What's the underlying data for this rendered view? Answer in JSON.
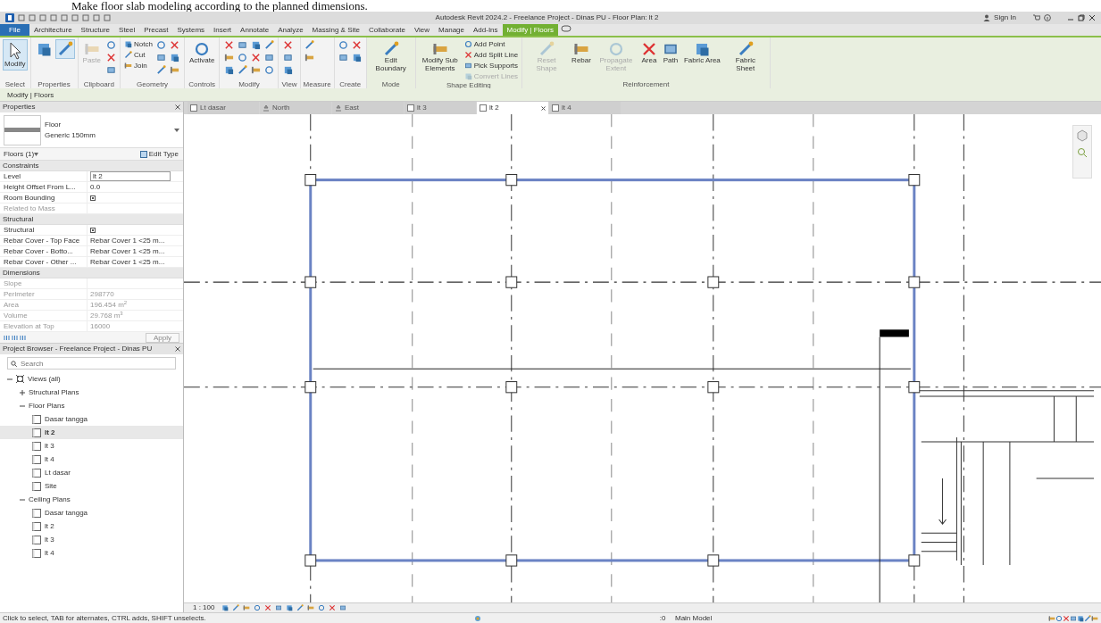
{
  "caption": "Make floor slab modeling according to the planned dimensions.",
  "title_bar": {
    "title": "Autodesk Revit 2024.2 - Freelance Project - Dinas PU - Floor Plan: lt 2",
    "sign_in": "Sign In"
  },
  "ribbon_tabs": [
    {
      "label": "File",
      "kind": "file",
      "selected": false
    },
    {
      "label": "Architecture",
      "kind": "tab",
      "selected": false
    },
    {
      "label": "Structure",
      "kind": "tab",
      "selected": false
    },
    {
      "label": "Steel",
      "kind": "tab",
      "selected": false
    },
    {
      "label": "Precast",
      "kind": "tab",
      "selected": false
    },
    {
      "label": "Systems",
      "kind": "tab",
      "selected": false
    },
    {
      "label": "Insert",
      "kind": "tab",
      "selected": false
    },
    {
      "label": "Annotate",
      "kind": "tab",
      "selected": false
    },
    {
      "label": "Analyze",
      "kind": "tab",
      "selected": false
    },
    {
      "label": "Massing & Site",
      "kind": "tab",
      "selected": false
    },
    {
      "label": "Collaborate",
      "kind": "tab",
      "selected": false
    },
    {
      "label": "View",
      "kind": "tab",
      "selected": false
    },
    {
      "label": "Manage",
      "kind": "tab",
      "selected": false
    },
    {
      "label": "Add-Ins",
      "kind": "tab",
      "selected": false
    },
    {
      "label": "Modify | Floors",
      "kind": "context",
      "selected": true
    }
  ],
  "ribbon_panels": [
    {
      "label": "Select",
      "buttons": [
        {
          "kind": "large",
          "label": "Modify",
          "selected": true
        }
      ]
    },
    {
      "label": "Properties",
      "buttons": [
        {
          "kind": "icon-large",
          "selected": false
        },
        {
          "kind": "icon-large",
          "selected": true
        }
      ]
    },
    {
      "label": "Clipboard",
      "buttons": [
        {
          "kind": "large",
          "label": "Paste",
          "disabled": true
        },
        {
          "kind": "icon"
        },
        {
          "kind": "icon"
        },
        {
          "kind": "icon"
        }
      ]
    },
    {
      "label": "Geometry",
      "buttons": [
        {
          "kind": "small",
          "label": "Notch"
        },
        {
          "kind": "small",
          "label": "Cut"
        },
        {
          "kind": "small",
          "label": "Join"
        },
        {
          "kind": "icon"
        },
        {
          "kind": "icon"
        },
        {
          "kind": "icon"
        },
        {
          "kind": "icon"
        },
        {
          "kind": "icon"
        },
        {
          "kind": "icon"
        }
      ]
    },
    {
      "label": "Controls",
      "buttons": [
        {
          "kind": "large",
          "label": "Activate"
        }
      ]
    },
    {
      "label": "Modify",
      "buttons": [
        {
          "kind": "icon"
        },
        {
          "kind": "icon"
        },
        {
          "kind": "icon"
        },
        {
          "kind": "icon"
        },
        {
          "kind": "icon"
        },
        {
          "kind": "icon"
        },
        {
          "kind": "icon"
        },
        {
          "kind": "icon"
        },
        {
          "kind": "icon"
        },
        {
          "kind": "icon"
        },
        {
          "kind": "icon"
        },
        {
          "kind": "icon"
        }
      ]
    },
    {
      "label": "View",
      "buttons": [
        {
          "kind": "icon"
        },
        {
          "kind": "icon"
        },
        {
          "kind": "icon"
        }
      ]
    },
    {
      "label": "Measure",
      "buttons": [
        {
          "kind": "icon"
        },
        {
          "kind": "icon"
        }
      ]
    },
    {
      "label": "Create",
      "buttons": [
        {
          "kind": "icon"
        },
        {
          "kind": "icon"
        },
        {
          "kind": "icon"
        },
        {
          "kind": "icon"
        }
      ]
    },
    {
      "label": "Mode",
      "buttons": [
        {
          "kind": "large",
          "label": "Edit Boundary"
        }
      ]
    },
    {
      "label": "Shape Editing",
      "buttons": [
        {
          "kind": "large",
          "label": "Modify Sub Elements"
        },
        {
          "kind": "small",
          "label": "Add Point"
        },
        {
          "kind": "small",
          "label": "Add Split Line"
        },
        {
          "kind": "small",
          "label": "Pick Supports"
        },
        {
          "kind": "small",
          "label": "Convert Lines",
          "disabled": true
        }
      ]
    },
    {
      "label": "Reinforcement",
      "buttons": [
        {
          "kind": "large",
          "label": "Reset Shape",
          "disabled": true
        },
        {
          "kind": "large",
          "label": "Rebar"
        },
        {
          "kind": "large",
          "label": "Propagate Extent",
          "disabled": true
        },
        {
          "kind": "large",
          "label": "Area"
        },
        {
          "kind": "large",
          "label": "Path"
        },
        {
          "kind": "large",
          "label": "Fabric Area"
        },
        {
          "kind": "large",
          "label": "Fabric Sheet"
        }
      ]
    }
  ],
  "context_bar": "Modify | Floors",
  "properties": {
    "title": "Properties",
    "type_family": "Floor",
    "type_name": "Generic 150mm",
    "filter": "Floors (1)",
    "edit_type": "Edit Type",
    "groups": [
      {
        "label": "Constraints",
        "rows": [
          {
            "name": "Level",
            "kind": "input",
            "value": "lt 2"
          },
          {
            "name": "Height Offset From L...",
            "kind": "text",
            "value": "0.0"
          },
          {
            "name": "Room Bounding",
            "kind": "checkbox",
            "checked": true
          },
          {
            "name": "Related to Mass",
            "kind": "text",
            "disabled": true
          }
        ]
      },
      {
        "label": "Structural",
        "rows": [
          {
            "name": "Structural",
            "kind": "checkbox",
            "checked": true
          },
          {
            "name": "Rebar Cover - Top Face",
            "kind": "text",
            "value": "Rebar Cover 1 <25 m..."
          },
          {
            "name": "Rebar Cover - Botto...",
            "kind": "text",
            "value": "Rebar Cover 1 <25 m..."
          },
          {
            "name": "Rebar Cover - Other ...",
            "kind": "text",
            "value": "Rebar Cover 1 <25 m..."
          }
        ]
      },
      {
        "label": "Dimensions",
        "rows": [
          {
            "name": "Slope",
            "kind": "text",
            "disabled": true
          },
          {
            "name": "Perimeter",
            "kind": "text",
            "value": "298770",
            "disabled": true
          },
          {
            "name": "Area",
            "kind": "text",
            "value": "196.454 m$^{2}$",
            "disabled": true
          },
          {
            "name": "Volume",
            "kind": "text",
            "value": "29.768 m$^{3}$",
            "disabled": true
          },
          {
            "name": "Elevation at Top",
            "kind": "text",
            "value": "16000",
            "disabled": true
          }
        ]
      }
    ],
    "apply": "Apply"
  },
  "project_browser": {
    "title": "Project Browser - Freelance Project - Dinas PU",
    "search": {
      "placeholder": "Search"
    },
    "tree": [
      {
        "label": "Views (all)",
        "kind": "root",
        "expanded": true,
        "children": [
          {
            "label": "Structural Plans",
            "kind": "folder",
            "expanded": false
          },
          {
            "label": "Floor Plans",
            "kind": "folder",
            "expanded": true,
            "children": [
              {
                "label": "Dasar tangga",
                "kind": "view",
                "selected": false
              },
              {
                "label": "lt 2",
                "kind": "view",
                "selected": true
              },
              {
                "label": "lt 3",
                "kind": "view",
                "selected": false
              },
              {
                "label": "lt 4",
                "kind": "view",
                "selected": false
              },
              {
                "label": "Lt dasar",
                "kind": "view",
                "selected": false
              },
              {
                "label": "Site",
                "kind": "view",
                "selected": false
              }
            ]
          },
          {
            "label": "Ceiling Plans",
            "kind": "folder",
            "expanded": true,
            "children": [
              {
                "label": "Dasar tangga",
                "kind": "view",
                "selected": false
              },
              {
                "label": "lt 2",
                "kind": "view",
                "selected": false
              },
              {
                "label": "lt 3",
                "kind": "view",
                "selected": false
              },
              {
                "label": "lt 4",
                "kind": "view",
                "selected": false
              }
            ]
          }
        ]
      }
    ]
  },
  "view_tabs": [
    {
      "label": "Lt dasar",
      "kind": "plan",
      "selected": false
    },
    {
      "label": "North",
      "kind": "elevation",
      "selected": false
    },
    {
      "label": "East",
      "kind": "elevation",
      "selected": false
    },
    {
      "label": "lt 3",
      "kind": "plan",
      "selected": false
    },
    {
      "label": "lt 2",
      "kind": "plan",
      "selected": true
    },
    {
      "label": "lt 4",
      "kind": "plan",
      "selected": false
    }
  ],
  "view_control_bar": {
    "scale": "1 : 100"
  },
  "status_bar": {
    "message": "Click to select, TAB for alternates, CTRL adds, SHIFT unselects.",
    "workset": ":0",
    "model": "Main Model"
  }
}
